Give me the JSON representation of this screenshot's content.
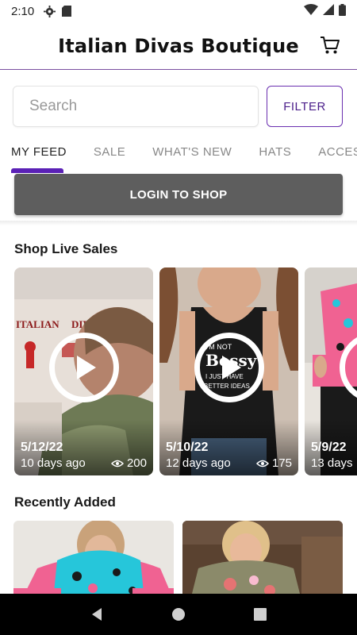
{
  "status_bar": {
    "time": "2:10"
  },
  "header": {
    "title": "Italian Divas Boutique"
  },
  "search": {
    "placeholder": "Search",
    "filter_label": "FILTER"
  },
  "tabs": [
    "MY FEED",
    "SALE",
    "WHAT'S NEW",
    "HATS",
    "ACCESS"
  ],
  "active_tab": "MY FEED",
  "login_label": "LOGIN TO SHOP",
  "live_sales": {
    "title": "Shop Live Sales",
    "cards": [
      {
        "date": "5/12/22",
        "ago": "10 days ago",
        "views": "200",
        "overlay_text": [
          "ITALIAN",
          "DIVAS"
        ]
      },
      {
        "date": "5/10/22",
        "ago": "12 days ago",
        "views": "175",
        "shirt_text": [
          "I'M NOT",
          "Bossy",
          "I JUST HAVE",
          "BETTER IDEAS"
        ]
      },
      {
        "date": "5/9/22",
        "ago": "13 days",
        "views": ""
      }
    ]
  },
  "recently_added": {
    "title": "Recently Added"
  },
  "colors": {
    "accent": "#5b21b6",
    "filter_border": "#6a2fb0",
    "login_bg": "#5e5e5e",
    "nav_bg": "#000000"
  }
}
